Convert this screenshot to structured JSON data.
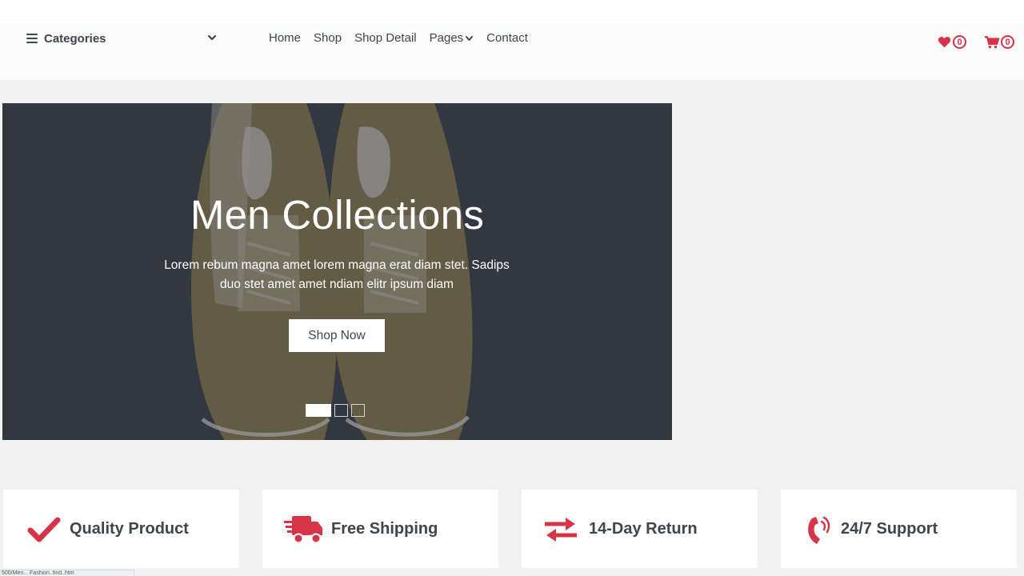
{
  "colors": {
    "accent": "#d63447",
    "text": "#3d464d",
    "hero_overlay": "#353c45"
  },
  "navbar": {
    "categories_label": "Categories",
    "links": [
      "Home",
      "Shop",
      "Shop Detail",
      "Pages",
      "Contact"
    ],
    "wishlist_count": "0",
    "cart_count": "0",
    "icons": {
      "menu": "bars-icon",
      "chevron": "chevron-down-icon",
      "wishlist": "heart-icon",
      "cart": "shopping-cart-icon"
    }
  },
  "hero": {
    "title": "Men Collections",
    "description": "Lorem rebum magna amet lorem magna erat diam stet. Sadips duo stet amet amet ndiam elitr ipsum diam",
    "button_label": "Shop Now",
    "slide_count": 3,
    "active_slide": 1
  },
  "features": [
    {
      "label": "Quality Product",
      "icon": "check-icon"
    },
    {
      "label": "Free Shipping",
      "icon": "shipping-fast-icon"
    },
    {
      "label": "14-Day Return",
      "icon": "exchange-icon"
    },
    {
      "label": "24/7 Support",
      "icon": "phone-volume-icon"
    }
  ],
  "status_bar": {
    "url": "500/Men... Fashion..find..htm"
  }
}
